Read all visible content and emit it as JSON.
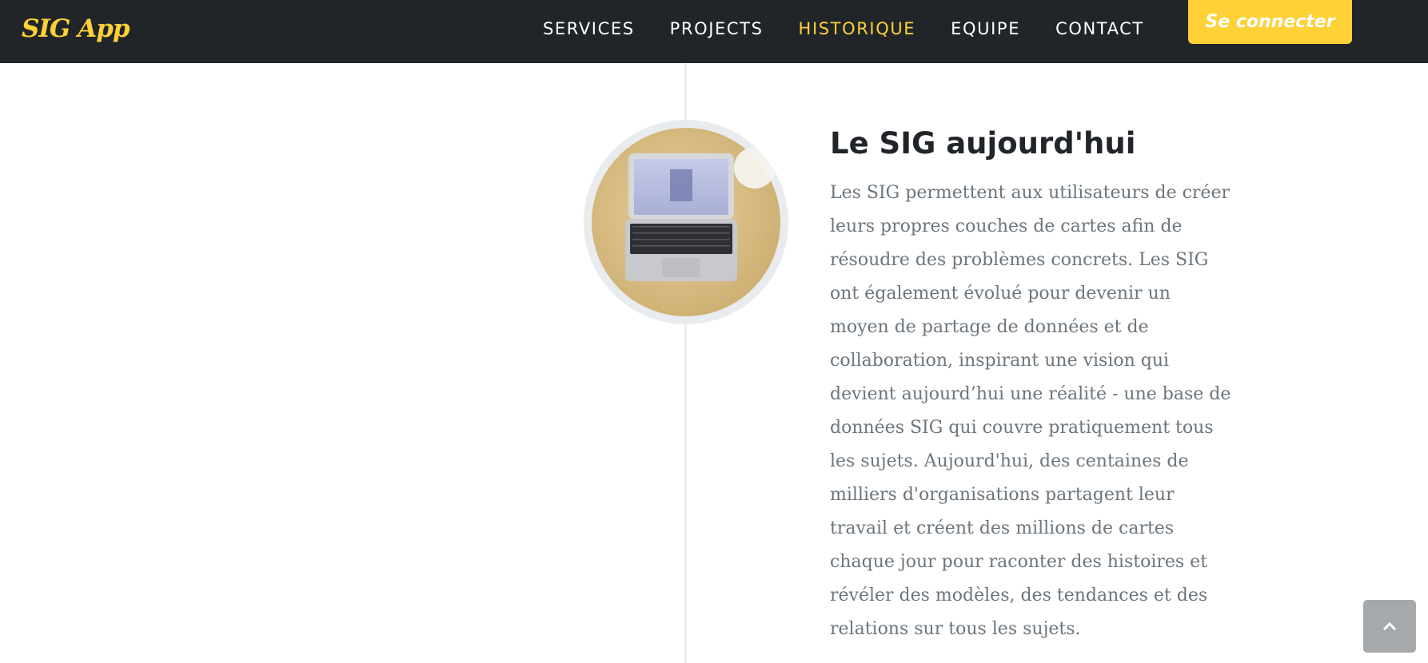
{
  "app": {
    "brand": "SIG App"
  },
  "nav": {
    "items": [
      {
        "label": "SERVICES",
        "active": false
      },
      {
        "label": "PROJECTS",
        "active": false
      },
      {
        "label": "HISTORIQUE",
        "active": true
      },
      {
        "label": "EQUIPE",
        "active": false
      },
      {
        "label": "CONTACT",
        "active": false
      }
    ],
    "login_label": "Se connecter"
  },
  "timeline": {
    "image_icon": "laptop-on-desk-photo",
    "heading": "Le SIG aujourd'hui",
    "body": "Les SIG permettent aux utilisateurs de créer leurs propres couches de cartes afin de résoudre des problèmes concrets. Les SIG ont également évolué pour devenir un moyen de partage de données et de collaboration, inspirant une vision qui devient aujourd’hui une réalité - une base de données SIG qui couvre pratiquement tous les sujets. Aujourd'hui, des centaines de milliers d'organisations partagent leur travail et créent des millions de cartes chaque jour pour raconter des histoires et révéler des modèles, des tendances et des relations sur tous les sujets."
  },
  "back_to_top": {
    "icon": "chevron-up-icon"
  },
  "colors": {
    "navbar_bg": "#212529",
    "accent": "#fed136",
    "heading": "#212529",
    "body_text": "#6c757d",
    "timeline_line": "#e9ecef",
    "back_to_top_bg": "#a6a9ac"
  }
}
